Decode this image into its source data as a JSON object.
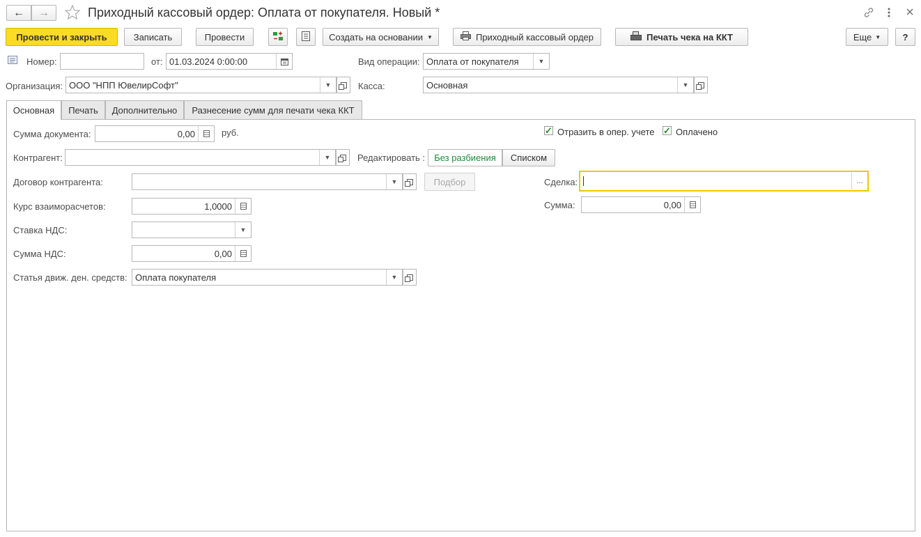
{
  "window": {
    "title": "Приходный кассовый ордер: Оплата от покупателя. Новый *",
    "nav_back": "←",
    "nav_forward": "→"
  },
  "toolbar": {
    "post_and_close": "Провести и закрыть",
    "save": "Записать",
    "post": "Провести",
    "create_based_on": "Создать на основании",
    "print_order": "Приходный кассовый ордер",
    "print_receipt": "Печать чека на ККТ",
    "more": "Еще",
    "help": "?"
  },
  "header": {
    "number_label": "Номер:",
    "number_value": "",
    "date_label": "от:",
    "date_value": "01.03.2024  0:00:00",
    "operation_label": "Вид операции:",
    "operation_value": "Оплата от покупателя",
    "organization_label": "Организация:",
    "organization_value": "ООО \"НПП ЮвелирСофт\"",
    "cashbox_label": "Касса:",
    "cashbox_value": "Основная"
  },
  "tabs": [
    {
      "label": "Основная",
      "active": true
    },
    {
      "label": "Печать",
      "active": false
    },
    {
      "label": "Дополнительно",
      "active": false
    },
    {
      "label": "Разнесение сумм для печати чека ККТ",
      "active": false
    }
  ],
  "main": {
    "doc_sum_label": "Сумма документа:",
    "doc_sum_value": "0,00",
    "currency": "руб.",
    "reflect_label": "Отразить в опер. учете",
    "reflect_checked": true,
    "paid_label": "Оплачено",
    "paid_checked": true,
    "counterparty_label": "Контрагент:",
    "counterparty_value": "",
    "edit_label": "Редактировать :",
    "edit_mode_single": "Без разбиения",
    "edit_mode_list": "Списком",
    "contract_label": "Договор контрагента:",
    "contract_value": "",
    "select_button": "Подбор",
    "deal_label": "Сделка:",
    "deal_value": "",
    "deal_more": "...",
    "rate_label": "Курс взаиморасчетов:",
    "rate_value": "1,0000",
    "sum_label": "Сумма:",
    "sum_value": "0,00",
    "vat_rate_label": "Ставка НДС:",
    "vat_rate_value": "",
    "vat_sum_label": "Сумма НДС:",
    "vat_sum_value": "0,00",
    "cashflow_label": "Статья движ. ден. средств:",
    "cashflow_value": "Оплата покупателя"
  },
  "colors": {
    "primary_button": "#fcdb26",
    "focus_border": "#f0c800",
    "active_mode_text": "#1d8a3a",
    "checkbox_mark": "#2a8a2a"
  }
}
